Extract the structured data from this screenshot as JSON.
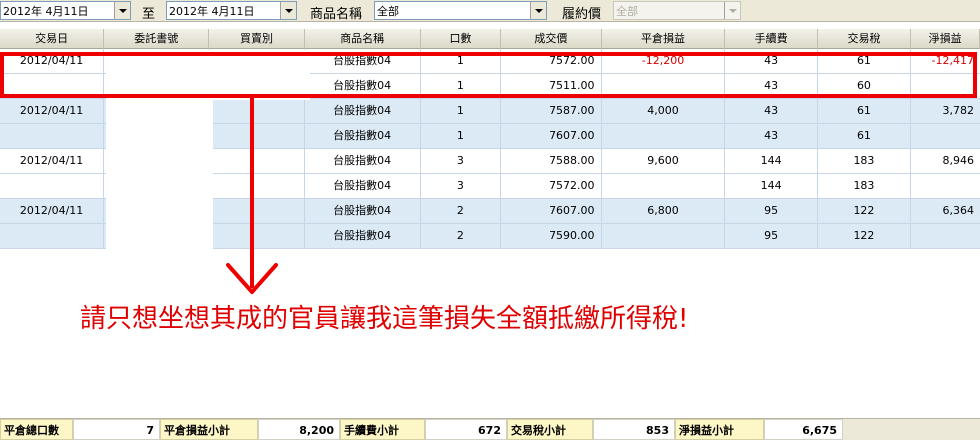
{
  "filters": {
    "date_from": "2012年  4月11日",
    "to_label": "至",
    "date_to": "2012年  4月11日",
    "product_label": "商品名稱",
    "product_value": "全部",
    "contract_label": "履約價",
    "contract_value": "全部"
  },
  "grid": {
    "headers": [
      "交易日",
      "委託書號",
      "買賣別",
      "商品名稱",
      "口數",
      "成交價",
      "平倉損益",
      "手續費",
      "交易稅",
      "淨損益"
    ],
    "rows": [
      {
        "date": "2012/04/11",
        "product": "台股指數04",
        "qty": "1",
        "price": "7572.00",
        "pnl": "-12,200",
        "fee": "43",
        "tax": "61",
        "net": "-12,417"
      },
      {
        "date": "",
        "product": "台股指數04",
        "qty": "1",
        "price": "7511.00",
        "pnl": "",
        "fee": "43",
        "tax": "60",
        "net": ""
      },
      {
        "date": "2012/04/11",
        "product": "台股指數04",
        "qty": "1",
        "price": "7587.00",
        "pnl": "4,000",
        "fee": "43",
        "tax": "61",
        "net": "3,782"
      },
      {
        "date": "",
        "product": "台股指數04",
        "qty": "1",
        "price": "7607.00",
        "pnl": "",
        "fee": "43",
        "tax": "61",
        "net": ""
      },
      {
        "date": "2012/04/11",
        "product": "台股指數04",
        "qty": "3",
        "price": "7588.00",
        "pnl": "9,600",
        "fee": "144",
        "tax": "183",
        "net": "8,946"
      },
      {
        "date": "",
        "product": "台股指數04",
        "qty": "3",
        "price": "7572.00",
        "pnl": "",
        "fee": "144",
        "tax": "183",
        "net": ""
      },
      {
        "date": "2012/04/11",
        "product": "台股指數04",
        "qty": "2",
        "price": "7607.00",
        "pnl": "6,800",
        "fee": "95",
        "tax": "122",
        "net": "6,364"
      },
      {
        "date": "",
        "product": "台股指數04",
        "qty": "2",
        "price": "7590.00",
        "pnl": "",
        "fee": "95",
        "tax": "122",
        "net": ""
      }
    ]
  },
  "annotation": {
    "text": "請只想坐想其成的官員讓我這筆損失全額抵繳所得稅!",
    "color": "#ee0000"
  },
  "footer": {
    "total_qty_label": "平倉總口數",
    "total_qty": "7",
    "pnl_label": "平倉損益小計",
    "pnl_value": "8,200",
    "fee_label": "手續費小計",
    "fee_value": "672",
    "tax_label": "交易稅小計",
    "tax_value": "853",
    "net_label": "淨損益小計",
    "net_value": "6,675"
  },
  "colors": {
    "row_blue": "#dceaf6",
    "negative": "#d40000",
    "footer_label_bg": "#fdf6c6"
  }
}
